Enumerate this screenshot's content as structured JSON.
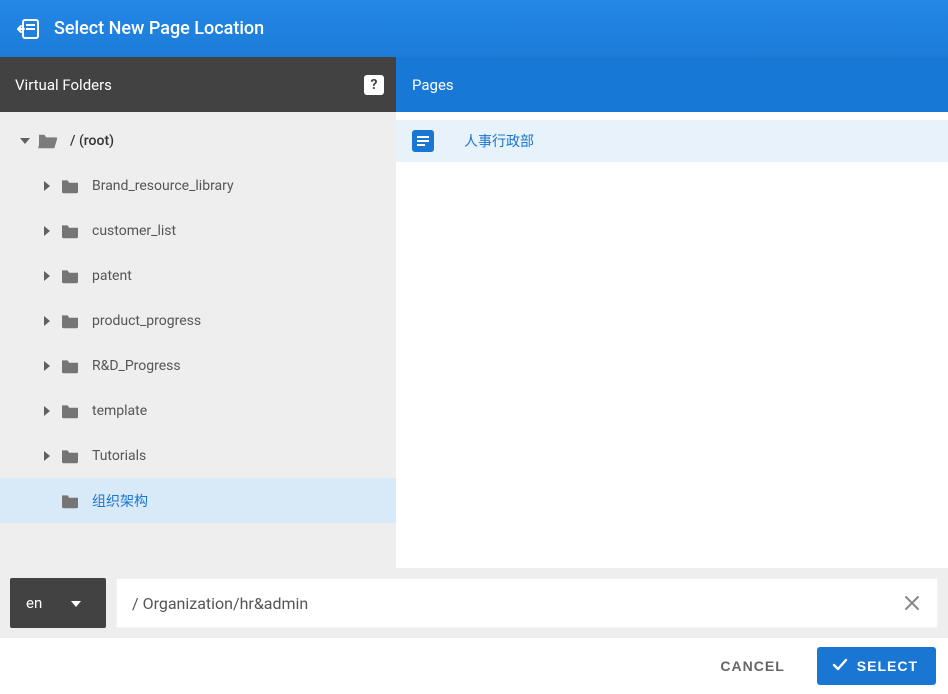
{
  "header": {
    "title": "Select New Page Location"
  },
  "left": {
    "title": "Virtual Folders",
    "help_tooltip": "?"
  },
  "tree": {
    "root_label": "/ (root)",
    "items": [
      {
        "label": "Brand_resource_library",
        "has_children": true,
        "selected": false
      },
      {
        "label": "customer_list",
        "has_children": true,
        "selected": false
      },
      {
        "label": "patent",
        "has_children": true,
        "selected": false
      },
      {
        "label": "product_progress",
        "has_children": true,
        "selected": false
      },
      {
        "label": "R&D_Progress",
        "has_children": true,
        "selected": false
      },
      {
        "label": "template",
        "has_children": true,
        "selected": false
      },
      {
        "label": "Tutorials",
        "has_children": true,
        "selected": false
      },
      {
        "label": "组织架构",
        "has_children": false,
        "selected": true
      }
    ]
  },
  "right": {
    "title": "Pages",
    "items": [
      {
        "label": "人事行政部"
      }
    ]
  },
  "path_bar": {
    "language": "en",
    "path_value": "/ Organization/hr&admin"
  },
  "footer": {
    "cancel_label": "CANCEL",
    "select_label": "SELECT"
  }
}
